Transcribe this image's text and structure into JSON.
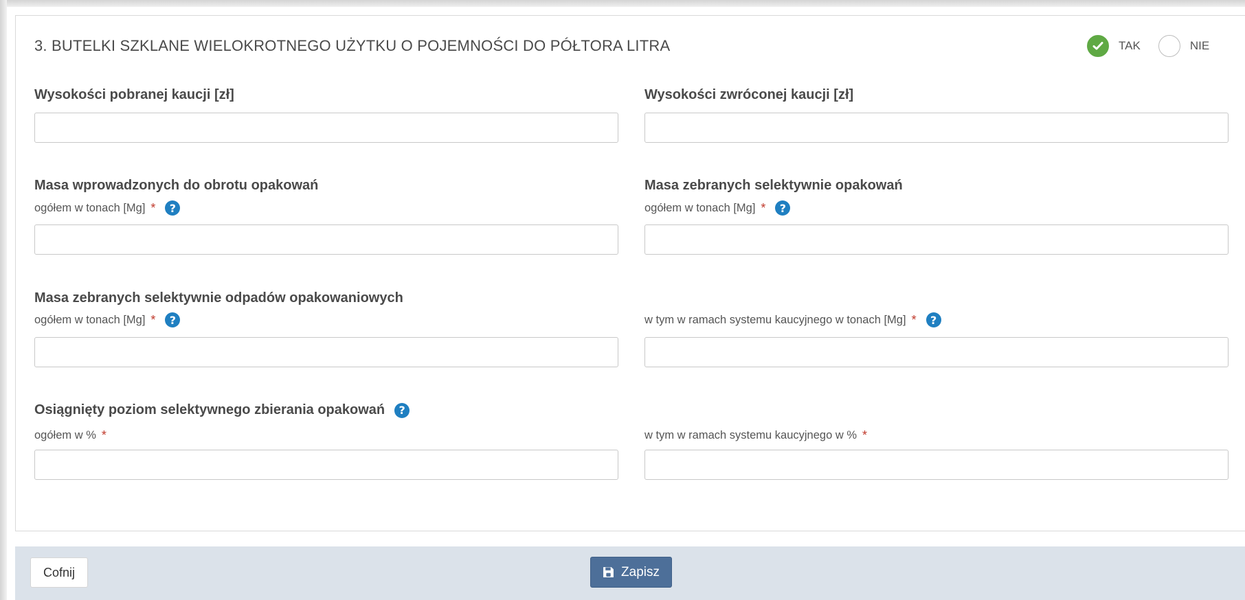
{
  "section": {
    "title": "3. BUTELKI SZKLANE WIELOKROTNEGO UŻYTKU O POJEMNOŚCI DO PÓŁTORA LITRA",
    "options": [
      {
        "label": "TAK",
        "checked": true
      },
      {
        "label": "NIE",
        "checked": false
      }
    ]
  },
  "fields": {
    "deposit_collected": {
      "label": "Wysokości pobranej kaucji [zł]",
      "value": ""
    },
    "deposit_returned": {
      "label": "Wysokości zwróconej kaucji [zł]",
      "value": ""
    },
    "mass_introduced": {
      "heading": "Masa wprowadzonych do obrotu opakowań",
      "label": "ogółem w tonach [Mg]",
      "value": ""
    },
    "mass_collected": {
      "heading": "Masa zebranych selektywnie opakowań",
      "label": "ogółem w tonach [Mg]",
      "value": ""
    },
    "waste_collected": {
      "heading": "Masa zebranych selektywnie odpadów opakowaniowych",
      "label": "ogółem w tonach [Mg]",
      "value": ""
    },
    "waste_deposit_system": {
      "label": "w tym w ramach systemu kaucyjnego w tonach [Mg]",
      "value": ""
    },
    "level_total": {
      "heading": "Osiągnięty poziom selektywnego zbierania opakowań",
      "label": "ogółem w %",
      "value": ""
    },
    "level_deposit_system": {
      "label": "w tym w ramach systemu kaucyjnego w %",
      "value": ""
    }
  },
  "required_mark": "*",
  "help_glyph": "?",
  "footer": {
    "back_label": "Cofnij",
    "save_label": "Zapisz"
  },
  "colors": {
    "check_green": "#5fa944",
    "help_blue": "#1f7fc1",
    "save_button": "#4d6f99",
    "footer_bg": "#dbe2ea",
    "required_red": "#c0392b"
  }
}
